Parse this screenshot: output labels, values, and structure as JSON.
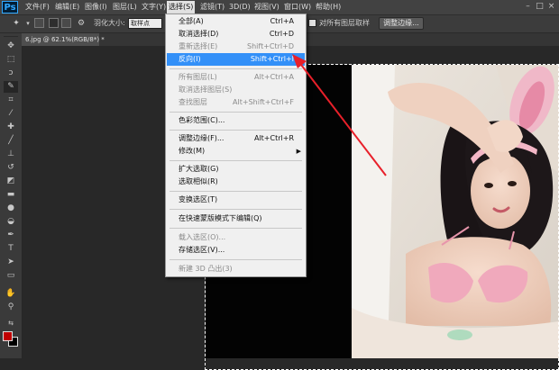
{
  "app": {
    "logo": "Ps"
  },
  "menubar": {
    "items": [
      "文件(F)",
      "编辑(E)",
      "图像(I)",
      "图层(L)",
      "文字(Y)",
      "选择(S)",
      "滤镜(T)",
      "3D(D)",
      "视图(V)",
      "窗口(W)",
      "帮助(H)"
    ],
    "active": "选择(S)"
  },
  "options": {
    "feather_label": "羽化大小:",
    "feather_value": "取样点",
    "all_layers_label": "对所有图层取样",
    "refine_edge_button": "调整边缘..."
  },
  "document": {
    "tab_title": "6.jpg @ 62.1%(RGB/8*) *"
  },
  "select_menu": [
    {
      "label": "全部(A)",
      "shortcut": "Ctrl+A",
      "enabled": true
    },
    {
      "label": "取消选择(D)",
      "shortcut": "Ctrl+D",
      "enabled": true
    },
    {
      "label": "重新选择(E)",
      "shortcut": "Shift+Ctrl+D",
      "enabled": false
    },
    {
      "label": "反向(I)",
      "shortcut": "Shift+Ctrl+I",
      "enabled": true,
      "highlighted": true
    },
    {
      "separator": true
    },
    {
      "label": "所有图层(L)",
      "shortcut": "Alt+Ctrl+A",
      "enabled": false
    },
    {
      "label": "取消选择图层(S)",
      "shortcut": "",
      "enabled": false
    },
    {
      "label": "查找图层",
      "shortcut": "Alt+Shift+Ctrl+F",
      "enabled": false
    },
    {
      "separator": true
    },
    {
      "label": "色彩范围(C)...",
      "shortcut": "",
      "enabled": true
    },
    {
      "separator": true
    },
    {
      "label": "调整边缘(F)...",
      "shortcut": "Alt+Ctrl+R",
      "enabled": true
    },
    {
      "label": "修改(M)",
      "shortcut": "",
      "enabled": true,
      "submenu": true
    },
    {
      "separator": true
    },
    {
      "label": "扩大选取(G)",
      "shortcut": "",
      "enabled": true
    },
    {
      "label": "选取相似(R)",
      "shortcut": "",
      "enabled": true
    },
    {
      "separator": true
    },
    {
      "label": "变换选区(T)",
      "shortcut": "",
      "enabled": true
    },
    {
      "separator": true
    },
    {
      "label": "在快速蒙版模式下编辑(Q)",
      "shortcut": "",
      "enabled": true
    },
    {
      "separator": true
    },
    {
      "label": "载入选区(O)...",
      "shortcut": "",
      "enabled": false
    },
    {
      "label": "存储选区(V)...",
      "shortcut": "",
      "enabled": true
    },
    {
      "separator": true
    },
    {
      "label": "新建 3D 凸出(3)",
      "shortcut": "",
      "enabled": false
    }
  ],
  "tools": [
    "move-icon",
    "marquee-icon",
    "lasso-icon",
    "quick-select-icon",
    "crop-icon",
    "eyedropper-icon",
    "healing-icon",
    "brush-icon",
    "clone-stamp-icon",
    "history-brush-icon",
    "eraser-icon",
    "gradient-icon",
    "blur-icon",
    "dodge-icon",
    "pen-icon",
    "type-icon",
    "path-select-icon",
    "rectangle-icon",
    "hand-icon",
    "zoom-icon"
  ],
  "colors": {
    "foreground": "#c00000",
    "background": "#000000",
    "menu_highlight": "#3390f8",
    "annotation_arrow": "#e8202a"
  }
}
